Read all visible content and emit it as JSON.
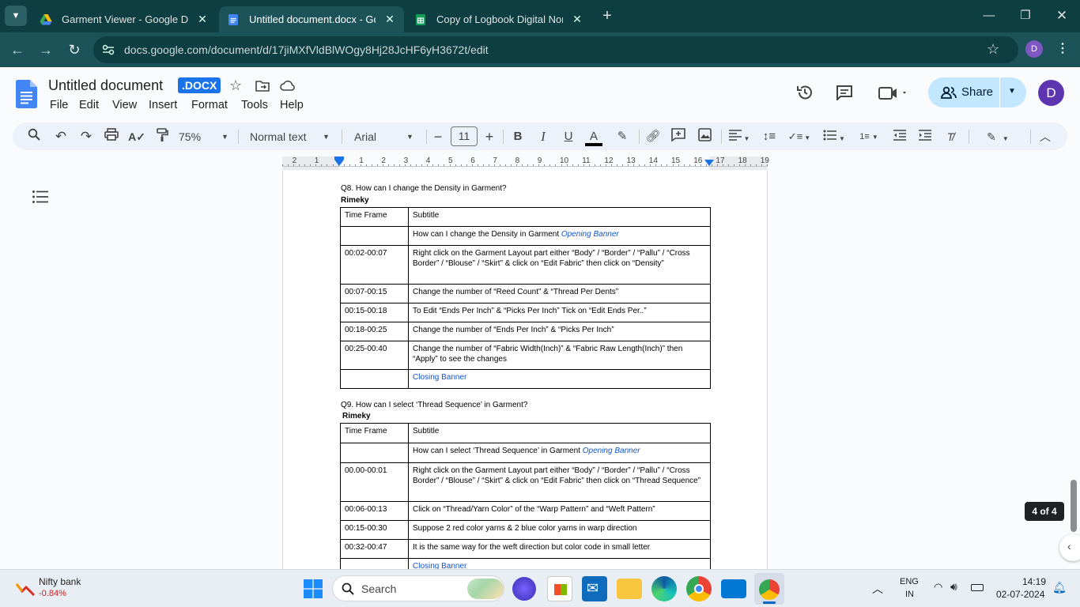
{
  "browser": {
    "tabs": [
      {
        "title": "Garment Viewer - Google Drive",
        "active": false
      },
      {
        "title": "Untitled document.docx - Goog",
        "active": true
      },
      {
        "title": "Copy of Logbook Digital North",
        "active": false
      }
    ],
    "url": "docs.google.com/document/d/17jiMXfVldBlWOgy8Hj28JcHF6yH3672t/edit",
    "profile_initial": "D"
  },
  "doc": {
    "title": "Untitled document",
    "badge": ".DOCX",
    "menu": [
      "File",
      "Edit",
      "View",
      "Insert",
      "Format",
      "Tools",
      "Help"
    ],
    "share_label": "Share",
    "avatar": "D"
  },
  "toolbar": {
    "zoom": "75%",
    "style": "Normal text",
    "font": "Arial",
    "font_size": "11"
  },
  "ruler": {
    "labels": [
      "2",
      "1",
      "1",
      "2",
      "3",
      "4",
      "5",
      "6",
      "7",
      "8",
      "9",
      "10",
      "11",
      "12",
      "13",
      "14",
      "15",
      "16",
      "17",
      "18",
      "19"
    ]
  },
  "content": {
    "q8": {
      "question": "Q8. How can I change the Density in Garment?",
      "author": "Rimeky",
      "header": [
        "Time Frame",
        "Subtitle"
      ],
      "rows": [
        {
          "time": "",
          "text": "How can I change the Density  in Garment ",
          "extra": "Opening Banner"
        },
        {
          "time": "00:02-00:07",
          "text": "Right click on the Garment Layout part either “Body” / “Border” / “Pallu” / “Cross Border” / “Blouse” / “Skirt” & click on “Edit Fabric” then click on “Density”"
        },
        {
          "time": "00:07-00:15",
          "text": "Change the number of “Reed Count” & “Thread Per Dents”"
        },
        {
          "time": "00:15-00:18",
          "text": "To Edit “Ends Per Inch” & “Picks Per Inch” Tick on “Edit Ends Per..”"
        },
        {
          "time": "00:18-00:25",
          "text": "Change the number of “Ends Per Inch” &  “Picks Per Inch”"
        },
        {
          "time": "00:25-00:40",
          "text": "Change the number of “Fabric Width(Inch)” &  “Fabric Raw Length(Inch)” then “Apply” to see the changes"
        },
        {
          "time": "",
          "link": "Closing Banner"
        }
      ]
    },
    "q9": {
      "question": "Q9.  How can I select ‘Thread Sequence’ in Garment?",
      "author": "Rimeky",
      "header": [
        "Time Frame",
        "Subtitle"
      ],
      "rows": [
        {
          "time": "",
          "text": "How can I select ‘Thread Sequence’ in Garment ",
          "extra": "Opening Banner"
        },
        {
          "time": "00.00-00:01",
          "text": "Right click on the Garment Layout part either “Body” / “Border” / “Pallu” / “Cross Border” / “Blouse” / “Skirt” & click on “Edit Fabric” then click on “Thread Sequence”"
        },
        {
          "time": "00:06-00:13",
          "text": "Click on “Thread/Yarn Color” of the “Warp Pattern” and “Weft Pattern”"
        },
        {
          "time": "00:15-00:30",
          "text": "Suppose 2 red color yarns & 2 blue color yarns in warp direction"
        },
        {
          "time": "00:32-00:47",
          "text": "It is the same way for the weft direction but color code in small letter"
        },
        {
          "time": "",
          "link": "Closing Banner"
        }
      ]
    },
    "page_counter": "4 of 4"
  },
  "taskbar": {
    "widget_name": "Nifty bank",
    "widget_value": "-0.84%",
    "search_placeholder": "Search",
    "lang_line1": "ENG",
    "lang_line2": "IN",
    "time": "14:19",
    "date": "02-07-2024"
  },
  "colors": {
    "tab_strip": "#0c3e42",
    "address_bar": "#1b5358",
    "share_button": "#c2e7ff",
    "docx_badge": "#1a73e8",
    "link_blue": "#1155cc"
  }
}
